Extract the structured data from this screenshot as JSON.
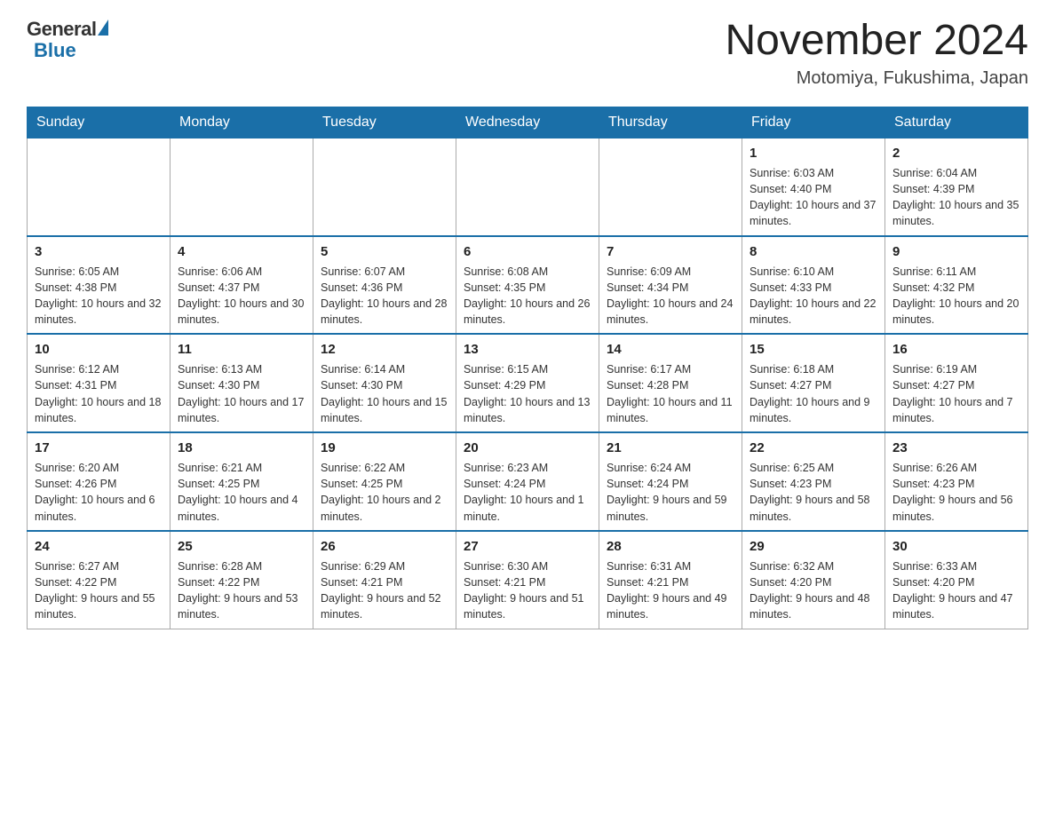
{
  "header": {
    "logo": {
      "general": "General",
      "blue": "Blue"
    },
    "title": "November 2024",
    "location": "Motomiya, Fukushima, Japan"
  },
  "days_of_week": [
    "Sunday",
    "Monday",
    "Tuesday",
    "Wednesday",
    "Thursday",
    "Friday",
    "Saturday"
  ],
  "weeks": [
    [
      {
        "day": "",
        "info": ""
      },
      {
        "day": "",
        "info": ""
      },
      {
        "day": "",
        "info": ""
      },
      {
        "day": "",
        "info": ""
      },
      {
        "day": "",
        "info": ""
      },
      {
        "day": "1",
        "info": "Sunrise: 6:03 AM\nSunset: 4:40 PM\nDaylight: 10 hours and 37 minutes."
      },
      {
        "day": "2",
        "info": "Sunrise: 6:04 AM\nSunset: 4:39 PM\nDaylight: 10 hours and 35 minutes."
      }
    ],
    [
      {
        "day": "3",
        "info": "Sunrise: 6:05 AM\nSunset: 4:38 PM\nDaylight: 10 hours and 32 minutes."
      },
      {
        "day": "4",
        "info": "Sunrise: 6:06 AM\nSunset: 4:37 PM\nDaylight: 10 hours and 30 minutes."
      },
      {
        "day": "5",
        "info": "Sunrise: 6:07 AM\nSunset: 4:36 PM\nDaylight: 10 hours and 28 minutes."
      },
      {
        "day": "6",
        "info": "Sunrise: 6:08 AM\nSunset: 4:35 PM\nDaylight: 10 hours and 26 minutes."
      },
      {
        "day": "7",
        "info": "Sunrise: 6:09 AM\nSunset: 4:34 PM\nDaylight: 10 hours and 24 minutes."
      },
      {
        "day": "8",
        "info": "Sunrise: 6:10 AM\nSunset: 4:33 PM\nDaylight: 10 hours and 22 minutes."
      },
      {
        "day": "9",
        "info": "Sunrise: 6:11 AM\nSunset: 4:32 PM\nDaylight: 10 hours and 20 minutes."
      }
    ],
    [
      {
        "day": "10",
        "info": "Sunrise: 6:12 AM\nSunset: 4:31 PM\nDaylight: 10 hours and 18 minutes."
      },
      {
        "day": "11",
        "info": "Sunrise: 6:13 AM\nSunset: 4:30 PM\nDaylight: 10 hours and 17 minutes."
      },
      {
        "day": "12",
        "info": "Sunrise: 6:14 AM\nSunset: 4:30 PM\nDaylight: 10 hours and 15 minutes."
      },
      {
        "day": "13",
        "info": "Sunrise: 6:15 AM\nSunset: 4:29 PM\nDaylight: 10 hours and 13 minutes."
      },
      {
        "day": "14",
        "info": "Sunrise: 6:17 AM\nSunset: 4:28 PM\nDaylight: 10 hours and 11 minutes."
      },
      {
        "day": "15",
        "info": "Sunrise: 6:18 AM\nSunset: 4:27 PM\nDaylight: 10 hours and 9 minutes."
      },
      {
        "day": "16",
        "info": "Sunrise: 6:19 AM\nSunset: 4:27 PM\nDaylight: 10 hours and 7 minutes."
      }
    ],
    [
      {
        "day": "17",
        "info": "Sunrise: 6:20 AM\nSunset: 4:26 PM\nDaylight: 10 hours and 6 minutes."
      },
      {
        "day": "18",
        "info": "Sunrise: 6:21 AM\nSunset: 4:25 PM\nDaylight: 10 hours and 4 minutes."
      },
      {
        "day": "19",
        "info": "Sunrise: 6:22 AM\nSunset: 4:25 PM\nDaylight: 10 hours and 2 minutes."
      },
      {
        "day": "20",
        "info": "Sunrise: 6:23 AM\nSunset: 4:24 PM\nDaylight: 10 hours and 1 minute."
      },
      {
        "day": "21",
        "info": "Sunrise: 6:24 AM\nSunset: 4:24 PM\nDaylight: 9 hours and 59 minutes."
      },
      {
        "day": "22",
        "info": "Sunrise: 6:25 AM\nSunset: 4:23 PM\nDaylight: 9 hours and 58 minutes."
      },
      {
        "day": "23",
        "info": "Sunrise: 6:26 AM\nSunset: 4:23 PM\nDaylight: 9 hours and 56 minutes."
      }
    ],
    [
      {
        "day": "24",
        "info": "Sunrise: 6:27 AM\nSunset: 4:22 PM\nDaylight: 9 hours and 55 minutes."
      },
      {
        "day": "25",
        "info": "Sunrise: 6:28 AM\nSunset: 4:22 PM\nDaylight: 9 hours and 53 minutes."
      },
      {
        "day": "26",
        "info": "Sunrise: 6:29 AM\nSunset: 4:21 PM\nDaylight: 9 hours and 52 minutes."
      },
      {
        "day": "27",
        "info": "Sunrise: 6:30 AM\nSunset: 4:21 PM\nDaylight: 9 hours and 51 minutes."
      },
      {
        "day": "28",
        "info": "Sunrise: 6:31 AM\nSunset: 4:21 PM\nDaylight: 9 hours and 49 minutes."
      },
      {
        "day": "29",
        "info": "Sunrise: 6:32 AM\nSunset: 4:20 PM\nDaylight: 9 hours and 48 minutes."
      },
      {
        "day": "30",
        "info": "Sunrise: 6:33 AM\nSunset: 4:20 PM\nDaylight: 9 hours and 47 minutes."
      }
    ]
  ]
}
